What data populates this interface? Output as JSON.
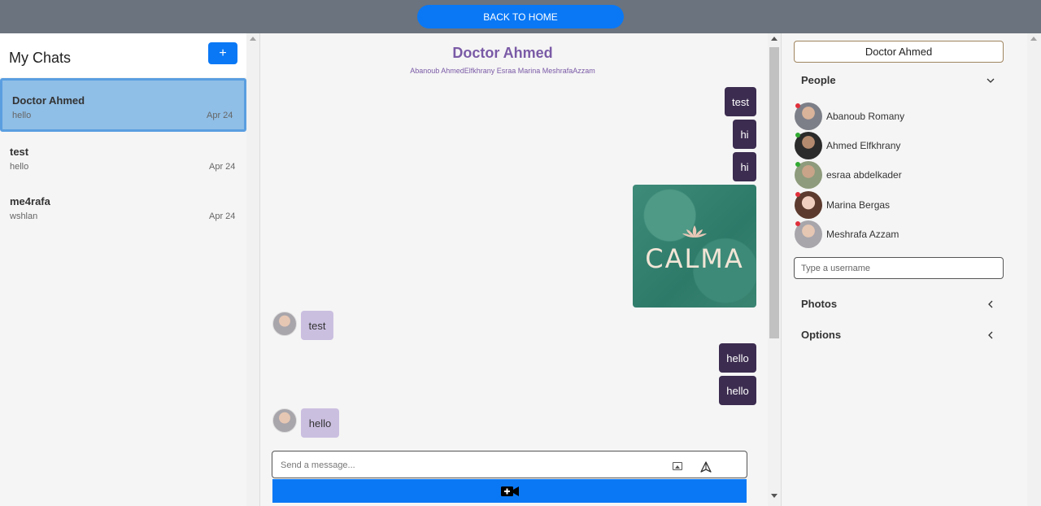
{
  "topbar": {
    "home_label": "BACK TO HOME"
  },
  "left": {
    "title": "My Chats",
    "add_label": "+",
    "chats": [
      {
        "name": "Doctor Ahmed",
        "last": "hello",
        "date": "Apr 24",
        "active": true
      },
      {
        "name": "test",
        "last": "hello",
        "date": "Apr 24",
        "active": false
      },
      {
        "name": "me4rafa",
        "last": "wshlan",
        "date": "Apr 24",
        "active": false
      }
    ]
  },
  "chat": {
    "title": "Doctor Ahmed",
    "members": "Abanoub AhmedElfkhrany Esraa Marina MeshrafaAzzam",
    "messages": [
      {
        "side": "out",
        "text": "test"
      },
      {
        "side": "out",
        "text": "hi"
      },
      {
        "side": "out",
        "text": "hi"
      },
      {
        "side": "out",
        "image_text": "CALMA"
      },
      {
        "side": "in",
        "text": "test"
      },
      {
        "side": "out",
        "text": "hello"
      },
      {
        "side": "out",
        "text": "hello"
      },
      {
        "side": "in",
        "text": "hello"
      }
    ],
    "input_placeholder": "Send a message...",
    "icons": {
      "attach": "image-icon",
      "send": "send-icon",
      "video": "video-call-icon"
    }
  },
  "right": {
    "title": "Doctor Ahmed",
    "people_label": "People",
    "people": [
      {
        "name": "Abanoub Romany",
        "status": "#e0303b"
      },
      {
        "name": "Ahmed Elfkhrany",
        "status": "#33aa33"
      },
      {
        "name": "esraa abdelkader",
        "status": "#33aa33"
      },
      {
        "name": "Marina Bergas",
        "status": "#e0303b"
      },
      {
        "name": "Meshrafa Azzam",
        "status": "#e0303b"
      }
    ],
    "search_placeholder": "Type a username",
    "photos_label": "Photos",
    "options_label": "Options"
  },
  "colors": {
    "accent": "#0a78f5",
    "outgoing": "#3c2c50",
    "incoming": "#cbbfe0",
    "title": "#7a5aa6"
  }
}
